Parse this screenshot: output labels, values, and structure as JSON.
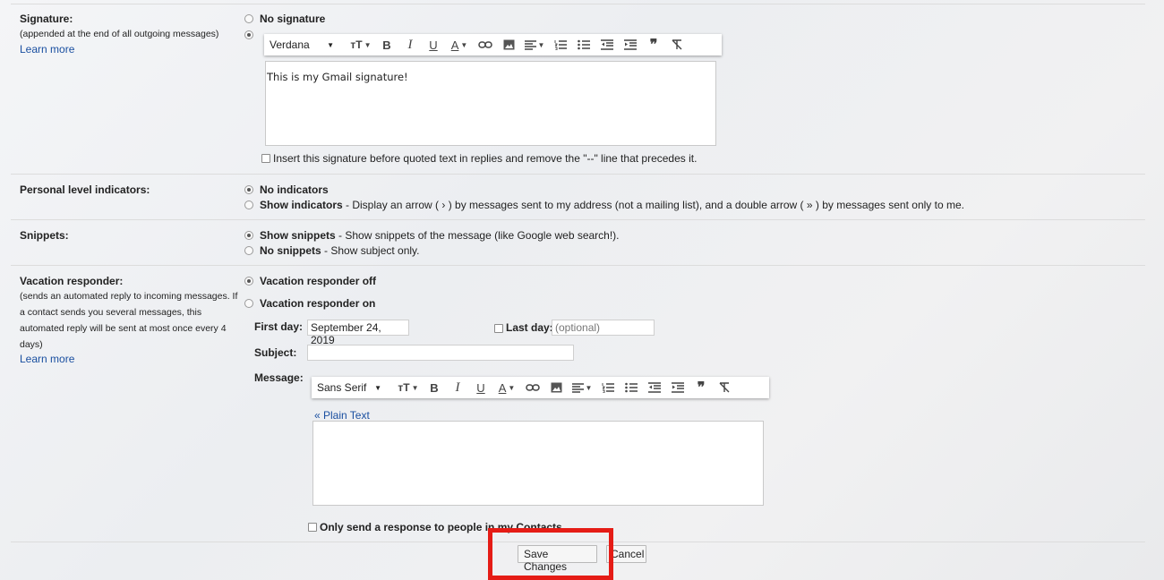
{
  "signature": {
    "label": "Signature:",
    "description": "(appended at the end of all outgoing messages)",
    "learn_more": "Learn more",
    "option_none": "No signature",
    "toolbar_font": "Verdana",
    "body_text": "This is my Gmail signature!",
    "insert_before_label": "Insert this signature before quoted text in replies and remove the \"--\" line that precedes it."
  },
  "personal_level": {
    "label": "Personal level indicators:",
    "opt_none": "No indicators",
    "opt_show": "Show indicators",
    "opt_show_desc": " - Display an arrow ( › ) by messages sent to my address (not a mailing list), and a double arrow ( » ) by messages sent only to me."
  },
  "snippets": {
    "label": "Snippets:",
    "opt_show": "Show snippets",
    "opt_show_desc": " - Show snippets of the message (like Google web search!).",
    "opt_none": "No snippets",
    "opt_none_desc": " - Show subject only."
  },
  "vacation": {
    "label": "Vacation responder:",
    "desc_line1": "(sends an automated reply to incoming messages. If",
    "desc_line2": "a contact sends you several messages, this",
    "desc_line3": "automated reply will be sent at most once every 4",
    "desc_line4": "days)",
    "learn_more": "Learn more",
    "opt_off": "Vacation responder off",
    "opt_on": "Vacation responder on",
    "first_day_label": "First day:",
    "first_day_value": "September 24, 2019",
    "last_day_label": "Last day:",
    "last_day_placeholder": "(optional)",
    "subject_label": "Subject:",
    "message_label": "Message:",
    "toolbar_font": "Sans Serif",
    "plain_text_link": "« Plain Text",
    "contacts_only_label": "Only send a response to people in my Contacts"
  },
  "actions": {
    "save": "Save Changes",
    "cancel": "Cancel"
  },
  "colors": {
    "highlight": "#e51c16",
    "link": "#1a4fa0"
  }
}
